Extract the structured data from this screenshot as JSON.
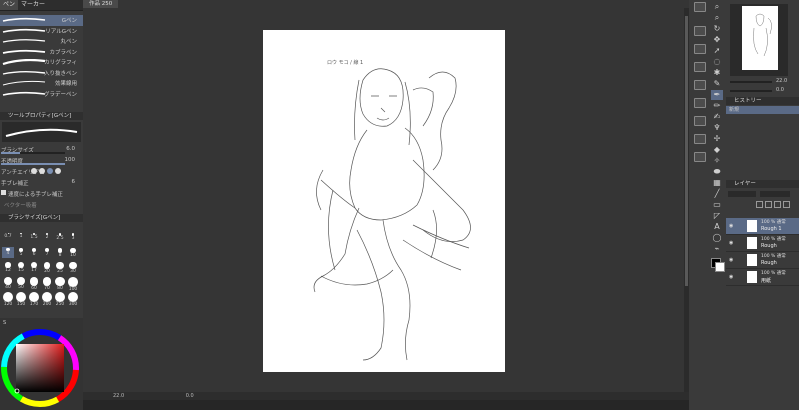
{
  "left_panel": {
    "tabs": [
      {
        "label": "ペン"
      },
      {
        "label": "マーカー"
      }
    ],
    "brushes": [
      {
        "label": "Gペン",
        "selected": true
      },
      {
        "label": "リアルGペン"
      },
      {
        "label": "丸ペン"
      },
      {
        "label": "カブラペン"
      },
      {
        "label": "カリグラフィ"
      },
      {
        "label": "入り抜きペン"
      },
      {
        "label": "効果線用"
      },
      {
        "label": "グラデーペン"
      }
    ],
    "tool_property": {
      "title": "ツールプロパティ[Gペン]",
      "brush_size_label": "ブラシサイズ",
      "brush_size_value": "6.0",
      "opacity_label": "不透明度",
      "opacity_value": "100",
      "antialias_label": "アンチエイリアス",
      "stabilization_label": "手ブレ補正",
      "stabilization_value": "6",
      "speed_correction_label": "速度による手ブレ補正",
      "vector_label": "ベクター吸着"
    },
    "brush_size_panel": {
      "title": "ブラシサイズ[Gペン]",
      "sizes": [
        "0.7",
        "1",
        "1.5",
        "2",
        "2.5",
        "3",
        "4",
        "5",
        "6",
        "7",
        "8",
        "10",
        "12",
        "15",
        "17",
        "20",
        "25",
        "30",
        "40",
        "50",
        "60",
        "70",
        "80",
        "100",
        "120",
        "150",
        "170",
        "200",
        "250",
        "300"
      ]
    },
    "color_wheel_label": "S"
  },
  "canvas": {
    "doc_tab": "作品 250",
    "zoom": "22.0",
    "angle": "0.0",
    "note_text": "ロウ モコ / 線 1"
  },
  "layers_panel": {
    "history_label": "ヒストリー",
    "history_item": "新規",
    "layer_title": "レイヤー",
    "layers": [
      {
        "pct": "100 % 通常",
        "name": "Rough 1",
        "selected": true
      },
      {
        "pct": "100 % 通常",
        "name": "Rough"
      },
      {
        "pct": "100 % 通常",
        "name": "Rough"
      },
      {
        "pct": "100 % 通常",
        "name": "用紙"
      }
    ],
    "navigator_zoom": "22.0",
    "navigator_angle": "0.0"
  },
  "colors": {
    "accent": "#5a6a86",
    "panel": "#3a3a3a",
    "canvas_bg": "#353535",
    "paper": "#ffffff"
  }
}
